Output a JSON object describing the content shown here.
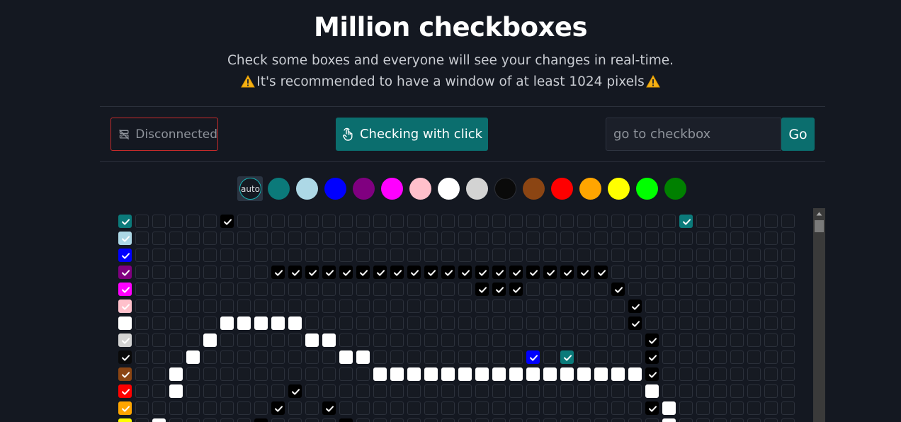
{
  "header": {
    "title": "Million checkboxes",
    "subtitle": "Check some boxes and everyone will see your changes in real-time.",
    "warning": "It's recommended to have a window of at least 1024 pixels"
  },
  "controls": {
    "status_label": "Disconnected",
    "status_icon": "server-off-icon",
    "mode_label": "Checking with click",
    "mode_icon": "pointer-click-icon",
    "goto_placeholder": "go to checkbox",
    "goto_value": "",
    "go_label": "Go"
  },
  "palette": {
    "auto_label": "auto",
    "selected": "auto",
    "colors": [
      "#0b7a7a",
      "#add8e6",
      "#0000ff",
      "#800080",
      "#ff00ff",
      "#ffc0cb",
      "#ffffff",
      "#d3d3d3",
      "#0a0a0a",
      "#8b4513",
      "#ff0000",
      "#ffa500",
      "#ffff00",
      "#00ff00",
      "#008000"
    ]
  },
  "grid": {
    "columns": 40,
    "row_colors": [
      "#0b7a7a",
      "#add8e6",
      "#0000ff",
      "#800080",
      "#ff00ff",
      "#ffc0cb",
      "#ffffff",
      "#d3d3d3",
      "#0a0a0a",
      "#8b4513",
      "#ff0000",
      "#ffa500",
      "#ffff00"
    ],
    "checked": [
      [
        [
          6,
          "#000000"
        ],
        [
          33,
          "#0b7a7a"
        ]
      ],
      [],
      [],
      [
        [
          9,
          "#000000"
        ],
        [
          10,
          "#000000"
        ],
        [
          11,
          "#000000"
        ],
        [
          12,
          "#000000"
        ],
        [
          13,
          "#000000"
        ],
        [
          14,
          "#000000"
        ],
        [
          15,
          "#000000"
        ],
        [
          16,
          "#000000"
        ],
        [
          17,
          "#000000"
        ],
        [
          18,
          "#000000"
        ],
        [
          19,
          "#000000"
        ],
        [
          20,
          "#000000"
        ],
        [
          21,
          "#000000"
        ],
        [
          22,
          "#000000"
        ],
        [
          23,
          "#000000"
        ],
        [
          24,
          "#000000"
        ],
        [
          25,
          "#000000"
        ],
        [
          26,
          "#000000"
        ],
        [
          27,
          "#000000"
        ],
        [
          28,
          "#000000"
        ]
      ],
      [
        [
          21,
          "#000000"
        ],
        [
          22,
          "#000000"
        ],
        [
          23,
          "#000000"
        ],
        [
          29,
          "#000000"
        ]
      ],
      [
        [
          30,
          "#000000"
        ]
      ],
      [
        [
          6,
          "#ffffff"
        ],
        [
          7,
          "#ffffff"
        ],
        [
          8,
          "#ffffff"
        ],
        [
          9,
          "#ffffff"
        ],
        [
          10,
          "#ffffff"
        ],
        [
          30,
          "#000000"
        ]
      ],
      [
        [
          5,
          "#ffffff"
        ],
        [
          11,
          "#ffffff"
        ],
        [
          12,
          "#ffffff"
        ],
        [
          31,
          "#000000"
        ]
      ],
      [
        [
          4,
          "#ffffff"
        ],
        [
          13,
          "#ffffff"
        ],
        [
          14,
          "#ffffff"
        ],
        [
          24,
          "#0000ff"
        ],
        [
          26,
          "#0b7a7a"
        ],
        [
          31,
          "#000000"
        ]
      ],
      [
        [
          3,
          "#ffffff"
        ],
        [
          15,
          "#ffffff"
        ],
        [
          16,
          "#ffffff"
        ],
        [
          17,
          "#ffffff"
        ],
        [
          18,
          "#ffffff"
        ],
        [
          19,
          "#ffffff"
        ],
        [
          20,
          "#ffffff"
        ],
        [
          21,
          "#ffffff"
        ],
        [
          22,
          "#ffffff"
        ],
        [
          23,
          "#ffffff"
        ],
        [
          24,
          "#ffffff"
        ],
        [
          25,
          "#ffffff"
        ],
        [
          26,
          "#ffffff"
        ],
        [
          27,
          "#ffffff"
        ],
        [
          28,
          "#ffffff"
        ],
        [
          29,
          "#ffffff"
        ],
        [
          30,
          "#ffffff"
        ],
        [
          31,
          "#000000"
        ]
      ],
      [
        [
          3,
          "#ffffff"
        ],
        [
          10,
          "#000000"
        ],
        [
          31,
          "#ffffff"
        ]
      ],
      [
        [
          9,
          "#000000"
        ],
        [
          12,
          "#000000"
        ],
        [
          31,
          "#000000"
        ],
        [
          32,
          "#ffffff"
        ]
      ],
      [
        [
          2,
          "#ffffff"
        ],
        [
          8,
          "#000000"
        ],
        [
          13,
          "#000000"
        ],
        [
          32,
          "#ffffff"
        ]
      ]
    ]
  }
}
